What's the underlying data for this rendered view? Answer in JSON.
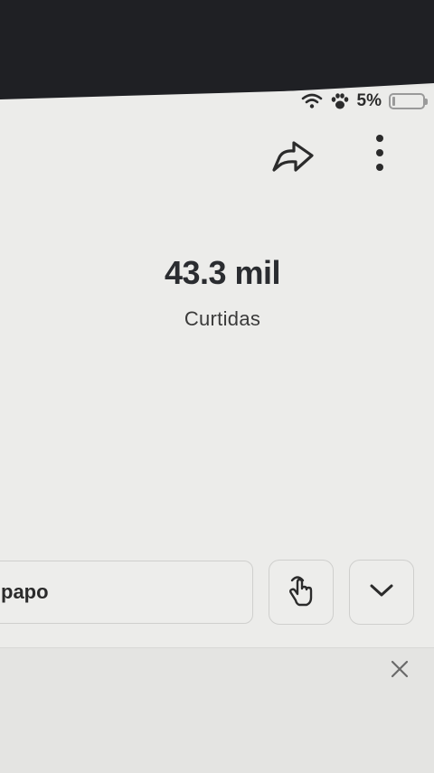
{
  "status_bar": {
    "battery_percent": "5%",
    "wifi_icon": "wifi-icon",
    "paw_icon": "paw-icon",
    "battery_icon": "battery-icon"
  },
  "toolbar": {
    "share_icon": "share-icon",
    "more_icon": "more-vertical-icon"
  },
  "stats": {
    "count": "43.3 mil",
    "label": "Curtidas"
  },
  "composer": {
    "value": "papo",
    "tap_icon": "hand-tap-icon",
    "chevron_icon": "chevron-down-icon"
  },
  "banner": {
    "close_icon": "close-icon"
  }
}
